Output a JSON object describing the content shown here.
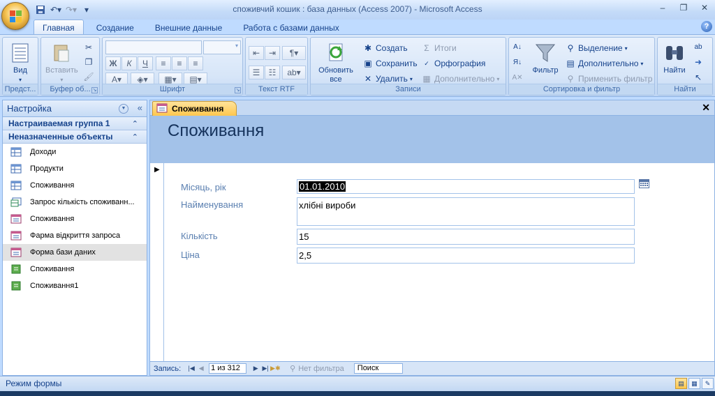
{
  "window": {
    "title": "споживчий кошик : база данных (Access 2007) - Microsoft Access"
  },
  "quick_access": [
    "save-icon",
    "undo-icon",
    "redo-icon",
    "customize-icon"
  ],
  "ribbon": {
    "tabs": [
      "Главная",
      "Создание",
      "Внешние данные",
      "Работа с базами данных"
    ],
    "active_tab": "Главная",
    "groups": {
      "views": {
        "label": "Предст...",
        "button": "Вид"
      },
      "clipboard": {
        "label": "Буфер об...",
        "paste": "Вставить"
      },
      "font": {
        "label": "Шрифт"
      },
      "rich_text": {
        "label": "Текст RTF"
      },
      "records": {
        "label": "Записи",
        "refresh": "Обновить",
        "refresh2": "все",
        "create": "Создать",
        "save": "Сохранить",
        "delete": "Удалить",
        "totals": "Итоги",
        "spelling": "Орфография",
        "more": "Дополнительно"
      },
      "sort_filter": {
        "label": "Сортировка и фильтр",
        "filter": "Фильтр",
        "selection": "Выделение",
        "advanced": "Дополнительно",
        "apply_filter": "Применить фильтр"
      },
      "find": {
        "label": "Найти",
        "button": "Найти"
      }
    }
  },
  "nav_pane": {
    "title": "Настройка",
    "groups": [
      {
        "label": "Настраиваемая группа 1"
      },
      {
        "label": "Неназначенные объекты"
      }
    ],
    "items": [
      {
        "label": "Доходи",
        "icon": "table-icon"
      },
      {
        "label": "Продукти",
        "icon": "table-icon"
      },
      {
        "label": "Споживання",
        "icon": "table-icon"
      },
      {
        "label": "Запрос кількість споживанн...",
        "icon": "query-icon"
      },
      {
        "label": "Споживання",
        "icon": "form-icon"
      },
      {
        "label": "Фарма відкриття запроса",
        "icon": "form-icon"
      },
      {
        "label": "Форма бази даних",
        "icon": "form-icon",
        "selected": true
      },
      {
        "label": "Споживання",
        "icon": "report-icon"
      },
      {
        "label": "Споживання1",
        "icon": "report-icon"
      }
    ]
  },
  "document": {
    "tab_label": "Споживання",
    "form_title": "Споживання",
    "fields": [
      {
        "label": "Місяць, рік",
        "value": "01.01.2010"
      },
      {
        "label": "Найменування",
        "value": "хлібні вироби"
      },
      {
        "label": "Кількість",
        "value": "15"
      },
      {
        "label": "Ціна",
        "value": "2,5"
      }
    ],
    "record_nav": {
      "label": "Запись:",
      "position": "1 из 312",
      "filter": "Нет фильтра",
      "search": "Поиск"
    }
  },
  "status_bar": {
    "text": "Режим формы"
  },
  "colors": {
    "ribbon": "#c9ddf6",
    "accent_tab": "#ffc74e",
    "form_header": "#a3c2e9",
    "label_text": "#5a7fb0"
  }
}
